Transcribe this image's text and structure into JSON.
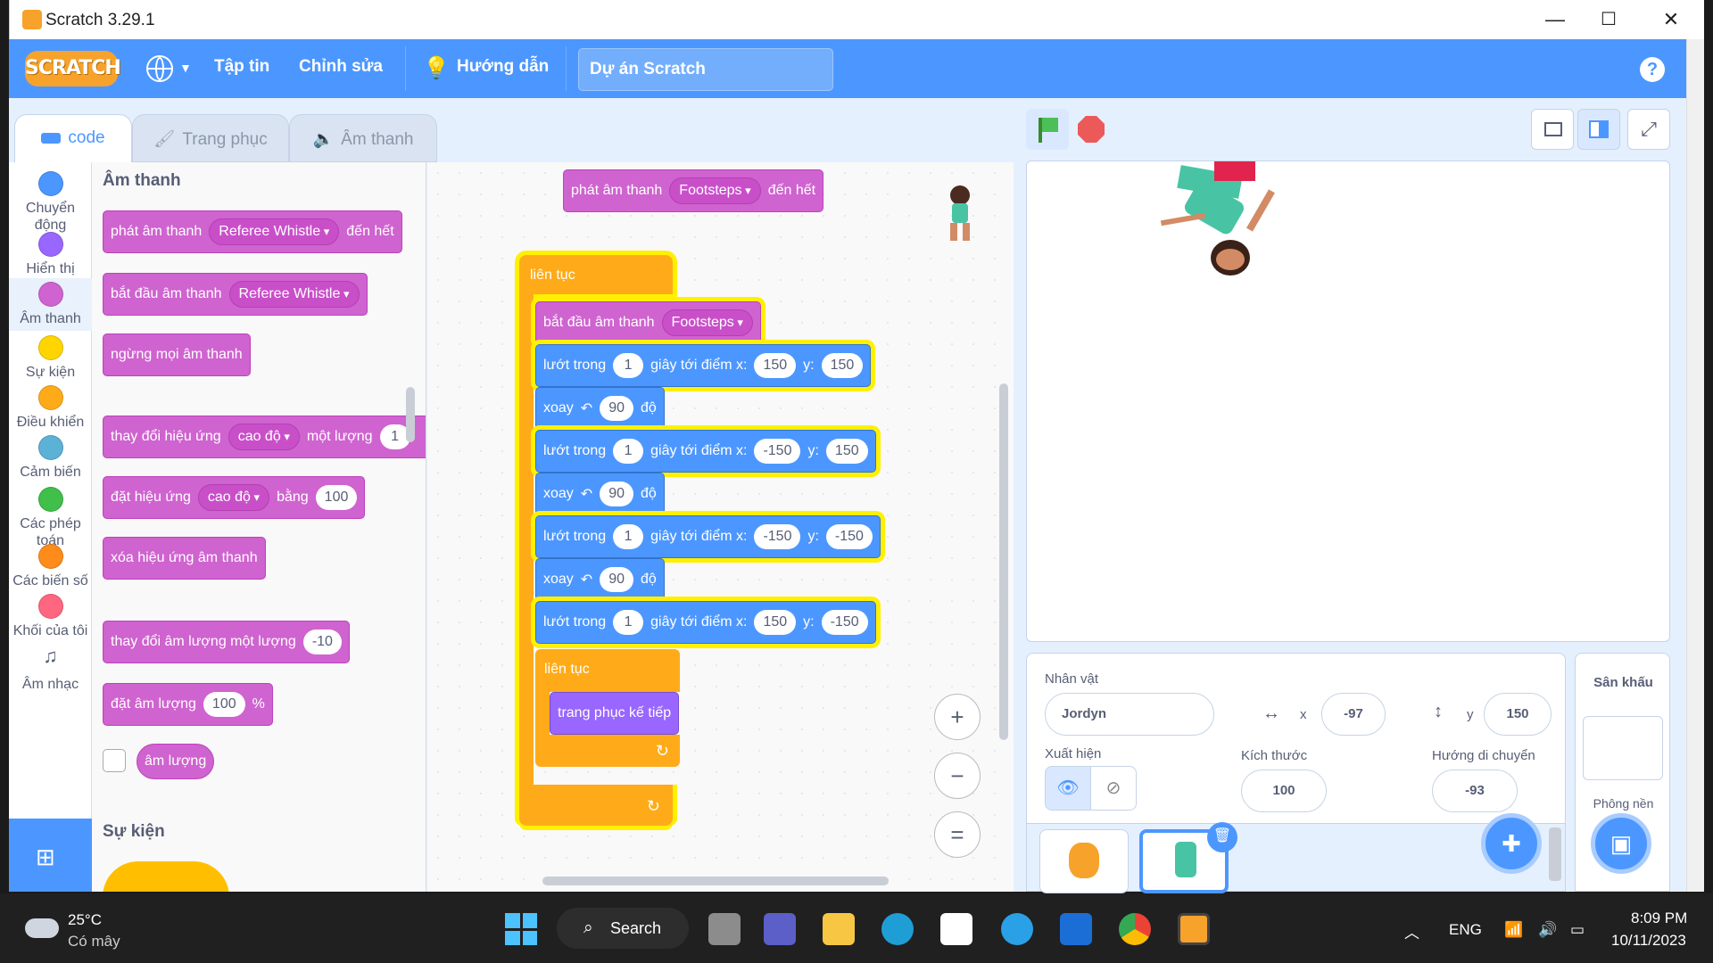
{
  "window": {
    "title": "Scratch 3.29.1"
  },
  "menu": {
    "logo": "SCRATCH",
    "file": "Tập tin",
    "edit": "Chỉnh sửa",
    "tutorials": "Hướng dẫn",
    "project_title": "Dự án Scratch",
    "help": "?"
  },
  "tabs": {
    "code": "code",
    "costumes": "Trang phục",
    "sounds": "Âm thanh"
  },
  "categories": [
    {
      "label": "Chuyển động",
      "color": "#4c97ff"
    },
    {
      "label": "Hiển thị",
      "color": "#9966ff"
    },
    {
      "label": "Âm thanh",
      "color": "#cf63cf"
    },
    {
      "label": "Sự kiện",
      "color": "#ffd500"
    },
    {
      "label": "Điều khiển",
      "color": "#ffab19"
    },
    {
      "label": "Cảm biến",
      "color": "#5cb1d6"
    },
    {
      "label": "Các phép toán",
      "color": "#40bf4a"
    },
    {
      "label": "Các biến số",
      "color": "#ff8c1a"
    },
    {
      "label": "Khối của tôi",
      "color": "#ff6680"
    },
    {
      "label": "Âm nhạc",
      "color": "#0fbd8c"
    }
  ],
  "palette": {
    "heading_sound": "Âm thanh",
    "play_until": {
      "a": "phát âm thanh",
      "dd": "Referee Whistle",
      "b": "đến hết"
    },
    "start_sound": {
      "a": "bắt đầu âm thanh",
      "dd": "Referee Whistle"
    },
    "stop_all": "ngừng mọi âm thanh",
    "change_effect": {
      "a": "thay đổi hiệu ứng",
      "dd": "cao độ",
      "b": "một lượng",
      "v": "1"
    },
    "set_effect": {
      "a": "đặt hiệu ứng",
      "dd": "cao độ",
      "b": "bằng",
      "v": "100"
    },
    "clear_effects": "xóa hiệu ứng âm thanh",
    "change_volume": {
      "a": "thay đổi âm lượng một lượng",
      "v": "-10"
    },
    "set_volume": {
      "a": "đặt âm lượng",
      "v": "100",
      "b": "%"
    },
    "volume": "âm lượng",
    "heading_events": "Sự kiện"
  },
  "script": {
    "play_until": {
      "a": "phát âm thanh",
      "dd": "Footsteps",
      "b": "đến hết"
    },
    "forever1": "liên tục",
    "start_sound": {
      "a": "bắt đầu âm thanh",
      "dd": "Footsteps"
    },
    "glide_a": "lướt trong",
    "glide_b": "giây tới điểm x:",
    "glide_y": "y:",
    "turn_a": "xoay",
    "turn_b": "độ",
    "glide1": {
      "s": "1",
      "x": "150",
      "y": "150"
    },
    "turn1": "90",
    "glide2": {
      "s": "1",
      "x": "-150",
      "y": "150"
    },
    "turn2": "90",
    "glide3": {
      "s": "1",
      "x": "-150",
      "y": "-150"
    },
    "turn3": "90",
    "glide4": {
      "s": "1",
      "x": "150",
      "y": "-150"
    },
    "forever2": "liên tục",
    "next_costume": "trang phục kế tiếp"
  },
  "zoom": {
    "in": "+",
    "out": "−",
    "reset": "="
  },
  "sprite": {
    "label_sprite": "Nhân vật",
    "name": "Jordyn",
    "x_label": "x",
    "x": "-97",
    "y_label": "y",
    "y": "150",
    "show_label": "Xuất hiện",
    "size_label": "Kích thước",
    "size": "100",
    "dir_label": "Hướng di chuyển",
    "dir": "-93"
  },
  "stage_panel": {
    "title": "Sân khấu",
    "backdrops": "Phông nền"
  },
  "taskbar": {
    "temp": "25°C",
    "weather": "Có mây",
    "search": "Search",
    "lang": "ENG",
    "time": "8:09 PM",
    "date": "10/11/2023"
  }
}
